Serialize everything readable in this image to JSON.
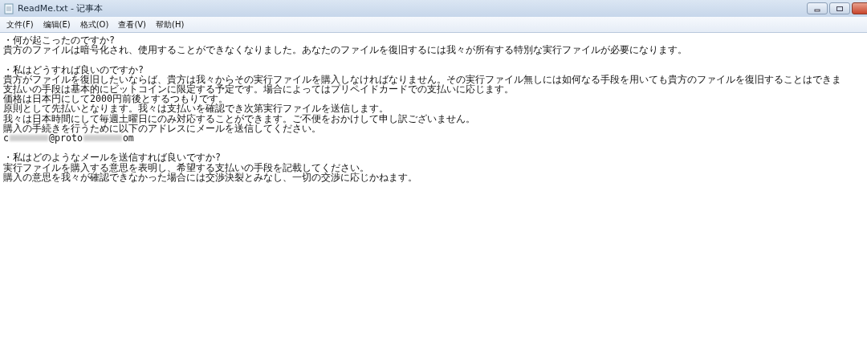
{
  "window": {
    "title": "ReadMe.txt - 记事本"
  },
  "menu": [
    "文件(F)",
    "编辑(E)",
    "格式(O)",
    "查看(V)",
    "帮助(H)"
  ],
  "lines": [
    {
      "kind": "text",
      "text": "・何が起こったのですか?"
    },
    {
      "kind": "text",
      "text": "貴方のファイルは暗号化され、使用することができなくなりました。あなたのファイルを復旧するには我々が所有する特別な実行ファイルが必要になります。"
    },
    {
      "kind": "blank"
    },
    {
      "kind": "text",
      "text": "・私はどうすれば良いのですか?"
    },
    {
      "kind": "text",
      "text": "貴方がファイルを復旧したいならば、貴方は我々からその実行ファイルを購入しなければなりません。その実行ファイル無しには如何なる手段を用いても貴方のファイルを復旧することはできま"
    },
    {
      "kind": "text",
      "text": "支払いの手段は基本的にビットコインに限定する予定です。場合によってはプリペイドカードでの支払いに応じます。"
    },
    {
      "kind": "text",
      "text": "価格は日本円にして2000円前後とするつもりです。"
    },
    {
      "kind": "text",
      "text": "原則として先払いとなります。我々は支払いを確認でき次第実行ファイルを送信します。"
    },
    {
      "kind": "text",
      "text": "我々は日本時間にして毎週土曜日にのみ対応することができます。ご不便をおかけして申し訳ございません。"
    },
    {
      "kind": "text",
      "text": "購入の手続きを行うために以下のアドレスにメールを送信してください。"
    },
    {
      "kind": "email",
      "parts": [
        {
          "kind": "text",
          "text": "c"
        },
        {
          "kind": "redacted"
        },
        {
          "kind": "text",
          "text": "@proto"
        },
        {
          "kind": "redacted"
        },
        {
          "kind": "text",
          "text": "om"
        }
      ]
    },
    {
      "kind": "blank"
    },
    {
      "kind": "text",
      "text": "・私はどのようなメールを送信すれば良いですか?"
    },
    {
      "kind": "text",
      "text": "実行ファイルを購入する意思を表明し、希望する支払いの手段を記載してください。"
    },
    {
      "kind": "text",
      "text": "購入の意思を我々が確認できなかった場合には交渉決裂とみなし、一切の交渉に応じかねます。"
    }
  ]
}
